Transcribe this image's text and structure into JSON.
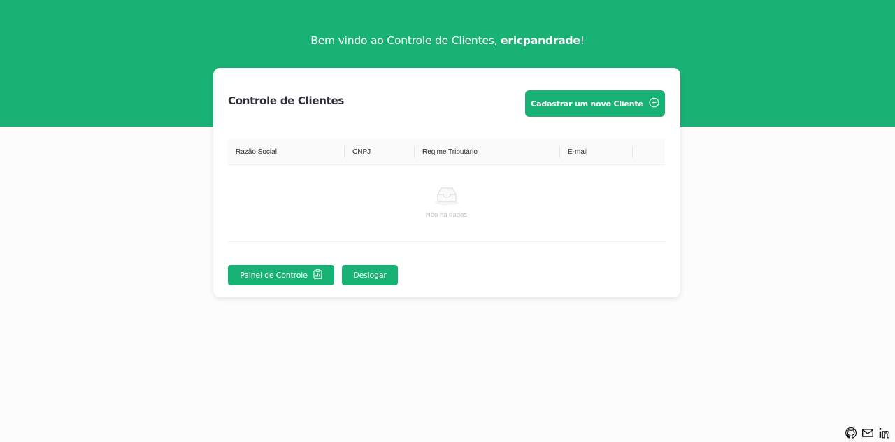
{
  "header": {
    "welcome_prefix": "Bem vindo ao Controle de Clientes, ",
    "username": "ericpandrade",
    "welcome_suffix": "!"
  },
  "card": {
    "title": "Controle de Clientes",
    "new_client_button": "Cadastrar um novo Cliente",
    "table": {
      "columns": [
        "Razão Social",
        "CNPJ",
        "Regime Tributário",
        "E-mail"
      ],
      "empty_text": "Não há dados"
    },
    "panel_button": "Painel de Controle",
    "logout_button": "Deslogar"
  },
  "footer": {
    "icons": [
      "github-icon",
      "mail-icon",
      "linkedin-icon"
    ]
  },
  "colors": {
    "accent": "#19b275",
    "background": "#fcfcfc"
  }
}
